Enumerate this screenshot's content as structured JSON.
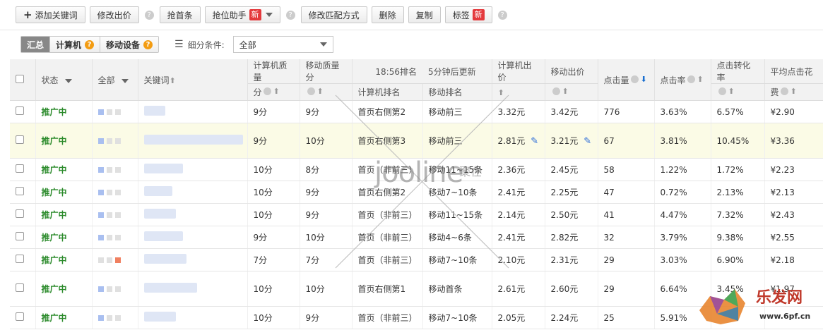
{
  "toolbar": {
    "add_keyword": "添加关键词",
    "modify_bid": "修改出价",
    "grab_first": "抢首条",
    "position_assistant": "抢位助手",
    "new_badge": "新",
    "modify_match": "修改匹配方式",
    "delete": "删除",
    "copy": "复制",
    "tag": "标签"
  },
  "filter": {
    "tabs": [
      "汇总",
      "计算机",
      "移动设备"
    ],
    "condition_label": "细分条件:",
    "condition_value": "全部"
  },
  "columns": {
    "status": "状态",
    "all": "全部",
    "keyword": "关键词",
    "pc_quality_1": "计算机质量",
    "pc_quality_2": "分",
    "mobile_quality_1": "移动质量分",
    "rank_time": "18:56排名",
    "rank_update": "5分钟后更新",
    "pc_rank": "计算机排名",
    "mobile_rank": "移动排名",
    "pc_bid": "计算机出价",
    "mobile_bid": "移动出价",
    "clicks": "点击量",
    "ctr": "点击率",
    "cvr": "点击转化率",
    "avg_cpc_1": "平均点击花",
    "avg_cpc_2": "费"
  },
  "rows": [
    {
      "status": "推广中",
      "pcq": "9分",
      "mq": "9分",
      "pcr": "首页右侧第2",
      "mr": "移动前三",
      "pcb": "3.32元",
      "mb": "3.42元",
      "clicks": "776",
      "ctr": "3.63%",
      "cvr": "6.57%",
      "cpc": "¥2.90"
    },
    {
      "status": "推广中",
      "pcq": "9分",
      "mq": "10分",
      "pcr": "首页右侧第3",
      "mr": "移动前三",
      "pcb": "2.81元",
      "mb": "3.21元",
      "clicks": "67",
      "ctr": "3.81%",
      "cvr": "10.45%",
      "cpc": "¥3.36"
    },
    {
      "status": "推广中",
      "pcq": "10分",
      "mq": "8分",
      "pcr": "首页（非前三）",
      "mr": "移动11~15条",
      "pcb": "2.36元",
      "mb": "2.45元",
      "clicks": "58",
      "ctr": "1.22%",
      "cvr": "1.72%",
      "cpc": "¥2.23"
    },
    {
      "status": "推广中",
      "pcq": "10分",
      "mq": "9分",
      "pcr": "首页右侧第2",
      "mr": "移动7~10条",
      "pcb": "2.41元",
      "mb": "2.25元",
      "clicks": "47",
      "ctr": "0.72%",
      "cvr": "2.13%",
      "cpc": "¥2.13"
    },
    {
      "status": "推广中",
      "pcq": "10分",
      "mq": "9分",
      "pcr": "首页（非前三）",
      "mr": "移动11~15条",
      "pcb": "2.14元",
      "mb": "2.50元",
      "clicks": "41",
      "ctr": "4.47%",
      "cvr": "7.32%",
      "cpc": "¥2.43"
    },
    {
      "status": "推广中",
      "pcq": "9分",
      "mq": "10分",
      "pcr": "首页（非前三）",
      "mr": "移动4~6条",
      "pcb": "2.41元",
      "mb": "2.82元",
      "clicks": "32",
      "ctr": "3.79%",
      "cvr": "9.38%",
      "cpc": "¥2.55"
    },
    {
      "status": "推广中",
      "pcq": "7分",
      "mq": "7分",
      "pcr": "首页（非前三）",
      "mr": "移动7~10条",
      "pcb": "2.10元",
      "mb": "2.31元",
      "clicks": "29",
      "ctr": "3.03%",
      "cvr": "6.90%",
      "cpc": "¥2.18"
    },
    {
      "status": "推广中",
      "pcq": "10分",
      "mq": "10分",
      "pcr": "首页右侧第1",
      "mr": "移动首条",
      "pcb": "2.61元",
      "mb": "2.60元",
      "clicks": "29",
      "ctr": "6.64%",
      "cvr": "3.45%",
      "cpc": "¥1.97"
    },
    {
      "status": "推广中",
      "pcq": "10分",
      "mq": "9分",
      "pcr": "首页（非前三）",
      "mr": "移动7~10条",
      "pcb": "2.05元",
      "mb": "2.24元",
      "clicks": "25",
      "ctr": "5.91%",
      "cvr": "",
      "cpc": ""
    }
  ],
  "watermark": {
    "text": "jooline",
    "cn": "聚在"
  },
  "logo": {
    "text": "乐发网",
    "url": "www.6pf.cn"
  }
}
